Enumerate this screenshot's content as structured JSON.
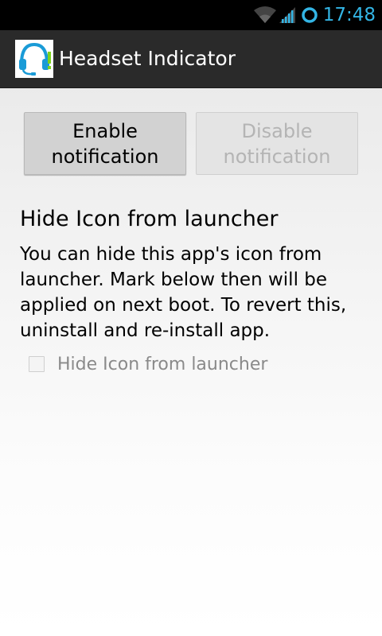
{
  "status_bar": {
    "time": "17:48",
    "icons": [
      "wifi-icon",
      "signal-icon",
      "sync-icon"
    ],
    "accent_color": "#33b5e5"
  },
  "action_bar": {
    "title": "Headset Indicator",
    "icon": "headset-icon"
  },
  "buttons": {
    "enable": {
      "line1": "Enable",
      "line2": "notification",
      "enabled": true
    },
    "disable": {
      "line1": "Disable",
      "line2": "notification",
      "enabled": false
    }
  },
  "hide_section": {
    "title": "Hide Icon from launcher",
    "description": "You can hide this app's icon from launcher. Mark below then will be applied on next boot. To revert this, uninstall and re-install app.",
    "checkbox_label": "Hide Icon from launcher",
    "checked": false
  }
}
